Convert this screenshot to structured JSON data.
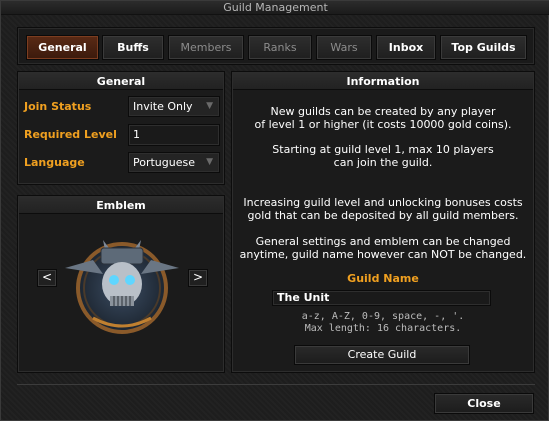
{
  "window": {
    "title": "Guild Management"
  },
  "tabs": [
    {
      "label": "General",
      "state": "active"
    },
    {
      "label": "Buffs",
      "state": "enabled"
    },
    {
      "label": "Members",
      "state": "disabled"
    },
    {
      "label": "Ranks",
      "state": "disabled"
    },
    {
      "label": "Wars",
      "state": "disabled"
    },
    {
      "label": "Inbox",
      "state": "enabled"
    },
    {
      "label": "Top Guilds",
      "state": "enabled"
    }
  ],
  "general": {
    "header": "General",
    "join_status": {
      "label": "Join Status",
      "value": "Invite Only"
    },
    "required_level": {
      "label": "Required Level",
      "value": "1"
    },
    "language": {
      "label": "Language",
      "value": "Portuguese"
    }
  },
  "emblem": {
    "header": "Emblem",
    "prev_label": "<",
    "next_label": ">"
  },
  "information": {
    "header": "Information",
    "para1_line1": "New guilds can be created by any player",
    "para1_line2": "of level 1 or higher (it costs 10000 gold coins).",
    "para2_line1": "Starting at guild level 1, max 10 players",
    "para2_line2": "can join the guild.",
    "para3_line1": "Increasing guild level and unlocking bonuses costs",
    "para3_line2": "gold that can be deposited by all guild members.",
    "para4_line1": "General settings and emblem can be changed",
    "para4_line2": "anytime, guild name however can NOT be changed.",
    "guild_name_label": "Guild Name",
    "guild_name_value": "The Unit",
    "rules_line1": "a-z, A-Z, 0-9, space, -, '.",
    "rules_line2": "Max length: 16 characters.",
    "create_button": "Create Guild"
  },
  "footer": {
    "close_button": "Close"
  },
  "colors": {
    "accent_gold": "#f0a020",
    "active_tab": "#5a2a15"
  }
}
